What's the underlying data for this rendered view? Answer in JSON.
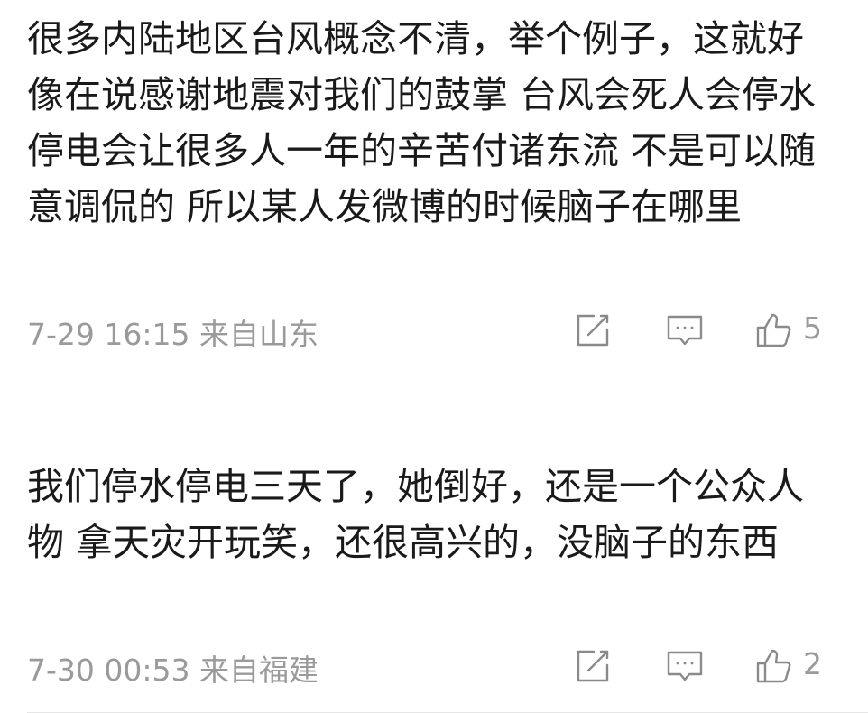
{
  "comments": [
    {
      "text": "很多内陆地区台风概念不清，举个例子，这就好像在说感谢地震对我们的鼓掌 台风会死人会停水停电会让很多人一年的辛苦付诸东流 不是可以随意调侃的 所以某人发微博的时候脑子在哪里",
      "timestamp": "7-29 16:15",
      "location": "来自山东",
      "likes": "5"
    },
    {
      "username": "",
      "text": "我们停水停电三天了，她倒好，还是一个公众人物 拿天灾开玩笑，还很高兴的，没脑子的东西",
      "timestamp": "7-30 00:53",
      "location": "来自福建",
      "likes": "2"
    }
  ],
  "icons": {
    "share": "share-edit-icon",
    "reply": "comment-bubble-icon",
    "like": "thumbs-up-icon"
  },
  "colors": {
    "text": "#1a1a1a",
    "meta": "#9a9a9a",
    "icon": "#8a8a8a",
    "divider": "#e6e6e6"
  }
}
